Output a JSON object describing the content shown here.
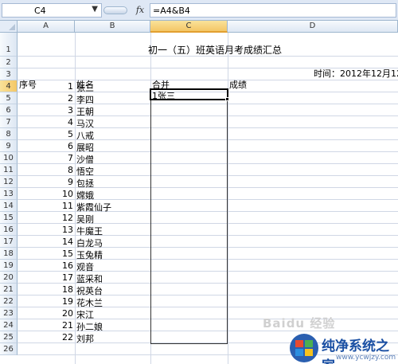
{
  "formula_bar": {
    "name_box": "C4",
    "fx_label": "fx",
    "formula": "=A4&B4"
  },
  "columns": [
    "A",
    "B",
    "C",
    "D"
  ],
  "rows": [
    "1",
    "2",
    "3",
    "4",
    "5",
    "6",
    "7",
    "8",
    "9",
    "10",
    "11",
    "12",
    "13",
    "14",
    "15",
    "16",
    "17",
    "18",
    "19",
    "20",
    "21",
    "22",
    "23",
    "24",
    "25",
    "26"
  ],
  "sheet": {
    "title": "初一（五）班英语月考成绩汇总",
    "time_label": "时间：2012年12月12",
    "headers": {
      "seq": "序号",
      "name": "姓名",
      "merge": "合并",
      "score": "成绩"
    },
    "students": [
      {
        "seq": "1",
        "name": "张三"
      },
      {
        "seq": "2",
        "name": "李四"
      },
      {
        "seq": "3",
        "name": "王朝"
      },
      {
        "seq": "4",
        "name": "马汉"
      },
      {
        "seq": "5",
        "name": "八戒"
      },
      {
        "seq": "6",
        "name": "展昭"
      },
      {
        "seq": "7",
        "name": "沙僧"
      },
      {
        "seq": "8",
        "name": "悟空"
      },
      {
        "seq": "9",
        "name": "包拯"
      },
      {
        "seq": "10",
        "name": "嫦娥"
      },
      {
        "seq": "11",
        "name": "紫霞仙子"
      },
      {
        "seq": "12",
        "name": "吴刚"
      },
      {
        "seq": "13",
        "name": "牛魔王"
      },
      {
        "seq": "14",
        "name": "白龙马"
      },
      {
        "seq": "15",
        "name": "玉兔精"
      },
      {
        "seq": "16",
        "name": "观音"
      },
      {
        "seq": "17",
        "name": "蓝采和"
      },
      {
        "seq": "18",
        "name": "祝英台"
      },
      {
        "seq": "19",
        "name": "花木兰"
      },
      {
        "seq": "20",
        "name": "宋江"
      },
      {
        "seq": "21",
        "name": "孙二娘"
      },
      {
        "seq": "22",
        "name": "刘邦"
      }
    ],
    "merged_value": "1张三"
  },
  "watermark": "Baidu 经验",
  "logo": {
    "name": "纯净系统之家",
    "url": "www.ycwjzy.com"
  },
  "colors": {
    "header_bg": "#dfe8f5",
    "active_header": "#f4c766",
    "grid": "#d0d7e5",
    "logo_blue": "#1a4fa3"
  }
}
